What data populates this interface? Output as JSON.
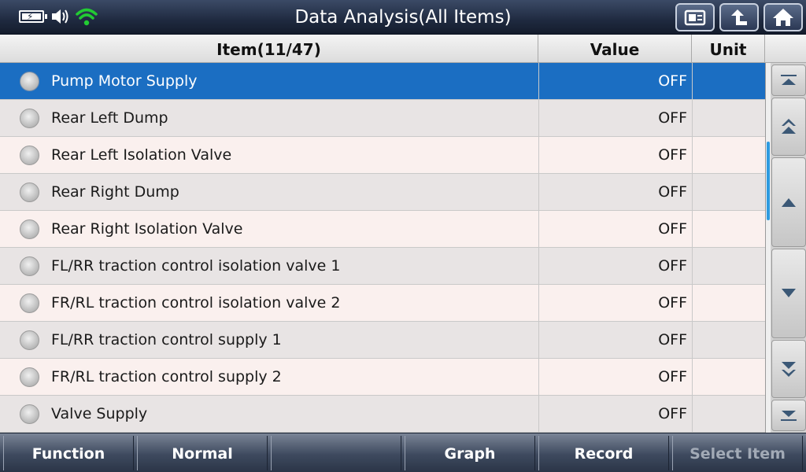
{
  "header": {
    "title": "Data Analysis(All Items)",
    "icons": [
      "battery-charging-icon",
      "speaker-icon",
      "wifi-icon",
      "report-icon",
      "back-icon",
      "home-icon"
    ],
    "colors": {
      "bar": "#1f2a40",
      "wifi": "#22cc33",
      "selected_row": "#1b6ec2"
    }
  },
  "table": {
    "columns": {
      "item": "Item(11/47)",
      "value": "Value",
      "unit": "Unit"
    },
    "rows": [
      {
        "name": "Pump Motor Supply",
        "value": "OFF",
        "unit": "",
        "selected": true
      },
      {
        "name": "Rear Left Dump",
        "value": "OFF",
        "unit": ""
      },
      {
        "name": "Rear Left Isolation Valve",
        "value": "OFF",
        "unit": ""
      },
      {
        "name": "Rear Right Dump",
        "value": "OFF",
        "unit": ""
      },
      {
        "name": "Rear Right Isolation Valve",
        "value": "OFF",
        "unit": ""
      },
      {
        "name": "FL/RR traction control isolation valve 1",
        "value": "OFF",
        "unit": ""
      },
      {
        "name": "FR/RL traction control isolation valve 2",
        "value": "OFF",
        "unit": ""
      },
      {
        "name": "FL/RR traction control supply 1",
        "value": "OFF",
        "unit": ""
      },
      {
        "name": "FR/RL traction control supply 2",
        "value": "OFF",
        "unit": ""
      },
      {
        "name": "Valve Supply",
        "value": "OFF",
        "unit": ""
      }
    ]
  },
  "scroll": {
    "buttons": [
      "scroll-top-icon",
      "page-up-icon",
      "scroll-up-icon",
      "scroll-down-icon",
      "page-down-icon",
      "scroll-bottom-icon"
    ]
  },
  "footer": {
    "buttons": [
      {
        "label": "Function",
        "enabled": true
      },
      {
        "label": "Normal",
        "enabled": true
      },
      {
        "label": "",
        "enabled": true
      },
      {
        "label": "Graph",
        "enabled": true
      },
      {
        "label": "Record",
        "enabled": true
      },
      {
        "label": "Select Item",
        "enabled": false
      }
    ]
  }
}
